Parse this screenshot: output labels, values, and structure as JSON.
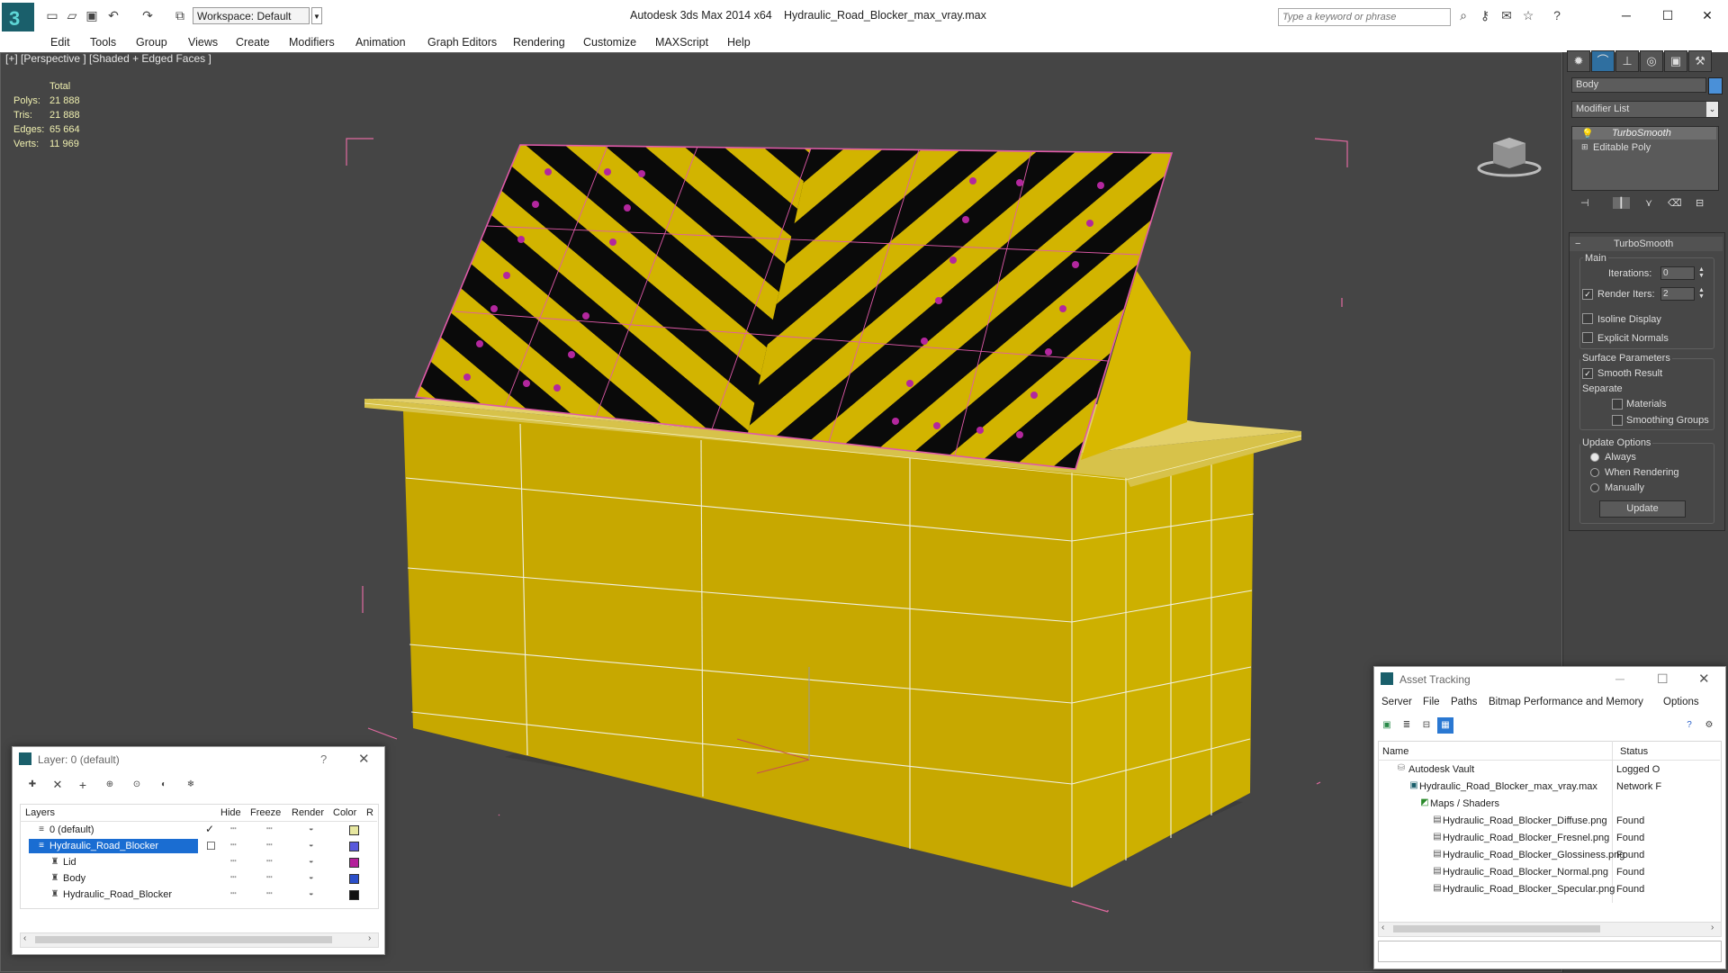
{
  "titlebar": {
    "app_title": "Autodesk 3ds Max  2014 x64",
    "file_title": "Hydraulic_Road_Blocker_max_vray.max",
    "workspace": "Workspace: Default",
    "search_placeholder": "Type a keyword or phrase"
  },
  "menu": [
    "Edit",
    "Tools",
    "Group",
    "Views",
    "Create",
    "Modifiers",
    "Animation",
    "Graph Editors",
    "Rendering",
    "Customize",
    "MAXScript",
    "Help"
  ],
  "viewport": {
    "label": "[+] [Perspective ] [Shaded + Edged Faces ]",
    "stats_header": "Total",
    "stats": [
      {
        "label": "Polys:",
        "value": "21 888"
      },
      {
        "label": "Tris:",
        "value": "21 888"
      },
      {
        "label": "Edges:",
        "value": "65 664"
      },
      {
        "label": "Verts:",
        "value": "11 969"
      }
    ],
    "colors": {
      "model": "#c7a800",
      "stripe_black": "#0a0a0a",
      "stripe_yellow": "#d2b400",
      "bolt": "#b3279e",
      "wire": "#f0f0f0",
      "bbox": "#e06aa0"
    }
  },
  "command_panel": {
    "object_name": "Body",
    "modifier_list": "Modifier List",
    "stack": [
      "TurboSmooth",
      "Editable Poly"
    ],
    "rollout_title": "TurboSmooth",
    "main_label": "Main",
    "iterations_label": "Iterations:",
    "iterations_value": "0",
    "render_iters_label": "Render Iters:",
    "render_iters_value": "2",
    "isoline": "Isoline Display",
    "explicit_normals": "Explicit Normals",
    "surface_params": "Surface Parameters",
    "smooth_result": "Smooth Result",
    "separate": "Separate",
    "materials": "Materials",
    "smoothing_groups": "Smoothing Groups",
    "update_options": "Update Options",
    "always": "Always",
    "when_rendering": "When Rendering",
    "manually": "Manually",
    "update_button": "Update"
  },
  "layer_window": {
    "title": "Layer: 0 (default)",
    "help": "?",
    "columns": [
      "Layers",
      "Hide",
      "Freeze",
      "Render",
      "Color",
      "R"
    ],
    "rows": [
      {
        "name": "0 (default)",
        "color": "#e7e7a0"
      },
      {
        "name": "Hydraulic_Road_Blocker",
        "color": "#5a5adc"
      },
      {
        "name": "Lid",
        "color": "#b4209a"
      },
      {
        "name": "Body",
        "color": "#2b4fc9"
      },
      {
        "name": "Hydraulic_Road_Blocker",
        "color": "#111111"
      }
    ]
  },
  "asset_window": {
    "title": "Asset Tracking",
    "menu": [
      "Server",
      "File",
      "Paths",
      "Bitmap Performance and Memory",
      "Options"
    ],
    "columns": [
      "Name",
      "Status"
    ],
    "rows": [
      {
        "name": "Autodesk Vault",
        "status": "Logged O"
      },
      {
        "name": "Hydraulic_Road_Blocker_max_vray.max",
        "status": "Network F"
      },
      {
        "name": "Maps / Shaders",
        "status": ""
      },
      {
        "name": "Hydraulic_Road_Blocker_Diffuse.png",
        "status": "Found"
      },
      {
        "name": "Hydraulic_Road_Blocker_Fresnel.png",
        "status": "Found"
      },
      {
        "name": "Hydraulic_Road_Blocker_Glossiness.png",
        "status": "Found"
      },
      {
        "name": "Hydraulic_Road_Blocker_Normal.png",
        "status": "Found"
      },
      {
        "name": "Hydraulic_Road_Blocker_Specular.png",
        "status": "Found"
      }
    ]
  }
}
